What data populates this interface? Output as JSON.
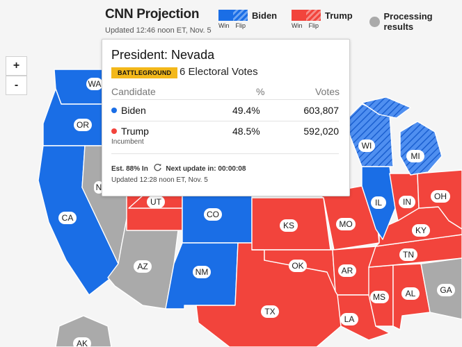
{
  "header": {
    "title": "CNN Projection",
    "updated": "Updated 12:46 noon ET, Nov. 5"
  },
  "legend": {
    "biden": {
      "label": "Biden",
      "win": "Win",
      "flip": "Flip"
    },
    "trump": {
      "label": "Trump",
      "win": "Win",
      "flip": "Flip"
    },
    "processing": {
      "label": "Processing results"
    }
  },
  "zoom": {
    "in": "+",
    "out": "-"
  },
  "popup": {
    "title": "President: Nevada",
    "badge": "BATTLEGROUND",
    "electoral_votes": "6 Electoral Votes",
    "headers": {
      "candidate": "Candidate",
      "percent": "%",
      "votes": "Votes"
    },
    "rows": [
      {
        "name": "Biden",
        "note": "",
        "percent": "49.4%",
        "votes": "603,807"
      },
      {
        "name": "Trump",
        "note": "Incumbent",
        "percent": "48.5%",
        "votes": "592,020"
      }
    ],
    "est": "Est. 88% In",
    "next_update": "Next update in: 00:00:08",
    "updated": "Updated 12:28 noon ET, Nov. 5"
  },
  "colors": {
    "biden": "#1a6ee6",
    "trump": "#f2443c",
    "processing": "#aaaaaa",
    "badge": "#f3b81a"
  },
  "states": {
    "WA": {
      "label": "WA",
      "status": "biden-win"
    },
    "OR": {
      "label": "OR",
      "status": "biden-win"
    },
    "CA": {
      "label": "CA",
      "status": "biden-win"
    },
    "NV": {
      "label": "N",
      "status": "processing"
    },
    "AZ": {
      "label": "AZ",
      "status": "processing"
    },
    "UT": {
      "label": "UT",
      "status": "trump-win"
    },
    "CO": {
      "label": "CO",
      "status": "biden-win"
    },
    "NM": {
      "label": "NM",
      "status": "biden-win"
    },
    "TX": {
      "label": "TX",
      "status": "trump-win"
    },
    "KS": {
      "label": "KS",
      "status": "trump-win"
    },
    "OK": {
      "label": "OK",
      "status": "trump-win"
    },
    "MO": {
      "label": "MO",
      "status": "trump-win"
    },
    "AR": {
      "label": "AR",
      "status": "trump-win"
    },
    "LA": {
      "label": "LA",
      "status": "trump-win"
    },
    "MS": {
      "label": "MS",
      "status": "trump-win"
    },
    "AL": {
      "label": "AL",
      "status": "trump-win"
    },
    "TN": {
      "label": "TN",
      "status": "trump-win"
    },
    "KY": {
      "label": "KY",
      "status": "trump-win"
    },
    "IN": {
      "label": "IN",
      "status": "trump-win"
    },
    "OH": {
      "label": "OH",
      "status": "trump-win"
    },
    "IL": {
      "label": "IL",
      "status": "biden-win"
    },
    "WI": {
      "label": "WI",
      "status": "biden-flip"
    },
    "MI": {
      "label": "MI",
      "status": "biden-flip"
    },
    "GA": {
      "label": "GA",
      "status": "processing"
    },
    "AK": {
      "label": "AK",
      "status": "processing"
    }
  }
}
